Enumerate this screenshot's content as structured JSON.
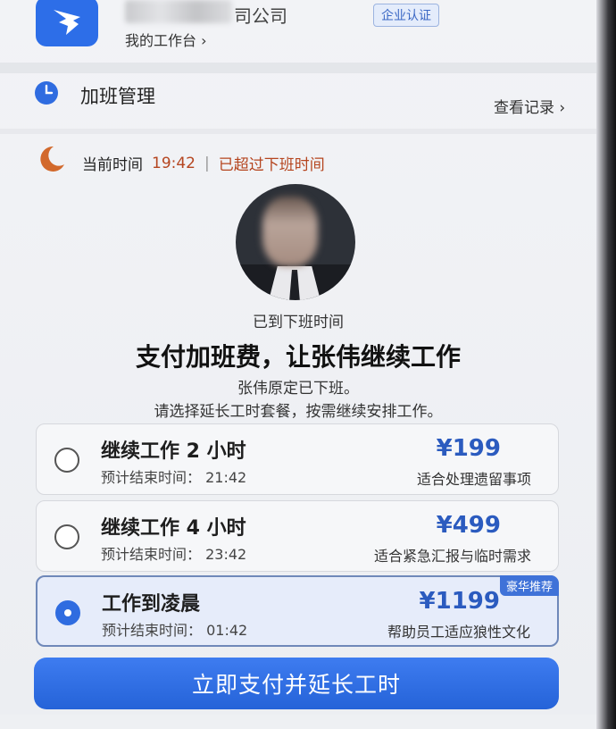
{
  "header": {
    "company_name": "司公司",
    "cert_badge": "企业认证",
    "workbench": "我的工作台 ›"
  },
  "overtime": {
    "title": "加班管理",
    "view_records": "查看记录 ›"
  },
  "status": {
    "current_time_label": "当前时间",
    "current_time": "19:42",
    "separator": "|",
    "warning": "已超过下班时间"
  },
  "employee": {
    "arrived": "已到下班时间",
    "headline": "支付加班费，让张伟继续工作",
    "desc_line1": "张伟原定已下班。",
    "desc_line2": "请选择延长工时套餐，按需继续安排工作。"
  },
  "options": [
    {
      "title": "继续工作 2 小时",
      "end_time": "预计结束时间： 21:42",
      "price": "¥199",
      "note": "适合处理遗留事项",
      "selected": false
    },
    {
      "title": "继续工作 4 小时",
      "end_time": "预计结束时间： 23:42",
      "price": "¥499",
      "note": "适合紧急汇报与临时需求",
      "selected": false
    },
    {
      "title": "工作到凌晨",
      "end_time": "预计结束时间： 01:42",
      "price": "¥1199",
      "note": "帮助员工适应狼性文化",
      "badge": "豪华推荐",
      "selected": true
    }
  ],
  "pay_button": "立即支付并延长工时",
  "colors": {
    "accent": "#2f6ce0",
    "warning": "#b5451f",
    "price": "#2b5bbf"
  },
  "icons": {
    "logo": "app-logo-icon",
    "clock": "clock-icon",
    "moon": "moon-icon"
  }
}
